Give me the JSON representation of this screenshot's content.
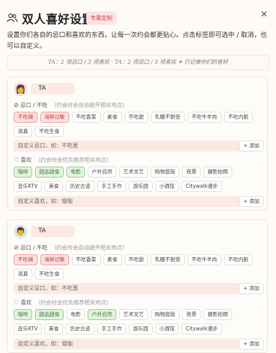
{
  "header": {
    "title": "双人喜好设置",
    "badge": "专属定制",
    "close_icon": "close-icon",
    "description": "设置你们各自的忌口和喜欢的东西，让每一次约会都更贴心。点击标签即可选中 / 取消，也可以自定义。",
    "summary": "TA：2 项忌口 / 3 项喜欢 · TA：2 项忌口 / 3 项喜欢 ✦ 已记录你们的喜好"
  },
  "people": [
    {
      "avatar": "👩",
      "name": "TA",
      "dislike_label": "忌口 / 不吃",
      "dislike_hint": "（约会时会自动避开相关地点）",
      "dislikes": [
        {
          "label": "不吃辣",
          "selected": true
        },
        {
          "label": "海鲜过敏",
          "selected": true
        },
        {
          "label": "不吃香菜",
          "selected": false
        },
        {
          "label": "素食",
          "selected": false
        },
        {
          "label": "不吃甜",
          "selected": false
        },
        {
          "label": "乳糖不耐受",
          "selected": false
        },
        {
          "label": "不吃牛羊肉",
          "selected": false
        },
        {
          "label": "不吃内脏",
          "selected": false
        },
        {
          "label": "清真",
          "selected": false
        },
        {
          "label": "不吃生食",
          "selected": false
        }
      ],
      "dislike_placeholder": "自定义忌口，如：不吃葱",
      "dislike_add": "+ 添加",
      "like_label": "喜欢",
      "like_hint": "（约会时会优先推荐相关地点）",
      "likes": [
        {
          "label": "咖啡",
          "selected": true
        },
        {
          "label": "甜品甜食",
          "selected": true
        },
        {
          "label": "电影",
          "selected": true
        },
        {
          "label": "户外自然",
          "selected": false
        },
        {
          "label": "艺术文艺",
          "selected": false
        },
        {
          "label": "购物逛街",
          "selected": false
        },
        {
          "label": "夜景",
          "selected": false
        },
        {
          "label": "摄影拍照",
          "selected": false
        },
        {
          "label": "音乐KTV",
          "selected": false
        },
        {
          "label": "美食",
          "selected": false
        },
        {
          "label": "历史古迹",
          "selected": false
        },
        {
          "label": "手工手作",
          "selected": false
        },
        {
          "label": "游乐园",
          "selected": false
        },
        {
          "label": "小酒馆",
          "selected": false
        },
        {
          "label": "Citywalk漫步",
          "selected": false
        }
      ],
      "like_placeholder": "自定义喜欢，如：猫咖",
      "like_add": "+ 添加"
    },
    {
      "avatar": "👨",
      "name": "TA",
      "dislike_label": "忌口 / 不吃",
      "dislike_hint": "（约会时会自动避开相关地点）",
      "dislikes": [
        {
          "label": "不吃辣",
          "selected": true
        },
        {
          "label": "海鲜过敏",
          "selected": true
        },
        {
          "label": "不吃香菜",
          "selected": false
        },
        {
          "label": "素食",
          "selected": false
        },
        {
          "label": "不吃甜",
          "selected": false
        },
        {
          "label": "乳糖不耐受",
          "selected": false
        },
        {
          "label": "不吃牛羊肉",
          "selected": false
        },
        {
          "label": "不吃内脏",
          "selected": false
        },
        {
          "label": "清真",
          "selected": false
        },
        {
          "label": "不吃生食",
          "selected": false
        }
      ],
      "dislike_placeholder": "自定义忌口，如：不吃葱",
      "dislike_add": "+ 添加",
      "like_label": "喜欢",
      "like_hint": "（约会时会优先推荐相关地点）",
      "likes": [
        {
          "label": "咖啡",
          "selected": true
        },
        {
          "label": "甜品甜食",
          "selected": true
        },
        {
          "label": "电影",
          "selected": false
        },
        {
          "label": "户外自然",
          "selected": true
        },
        {
          "label": "艺术文艺",
          "selected": false
        },
        {
          "label": "购物逛街",
          "selected": false
        },
        {
          "label": "夜景",
          "selected": false
        },
        {
          "label": "摄影拍照",
          "selected": false
        },
        {
          "label": "音乐KTV",
          "selected": false
        },
        {
          "label": "美食",
          "selected": false
        },
        {
          "label": "历史古迹",
          "selected": false
        },
        {
          "label": "手工手作",
          "selected": false
        },
        {
          "label": "游乐园",
          "selected": false
        },
        {
          "label": "小酒馆",
          "selected": false
        },
        {
          "label": "Citywalk漫步",
          "selected": false
        }
      ],
      "like_placeholder": "自定义喜欢，如：猫咖",
      "like_add": "+ 添加"
    }
  ],
  "colors": {
    "dislike_selected": "#fbe1e1",
    "like_selected": "#e3f2df",
    "badge": "#fbe3e3"
  }
}
